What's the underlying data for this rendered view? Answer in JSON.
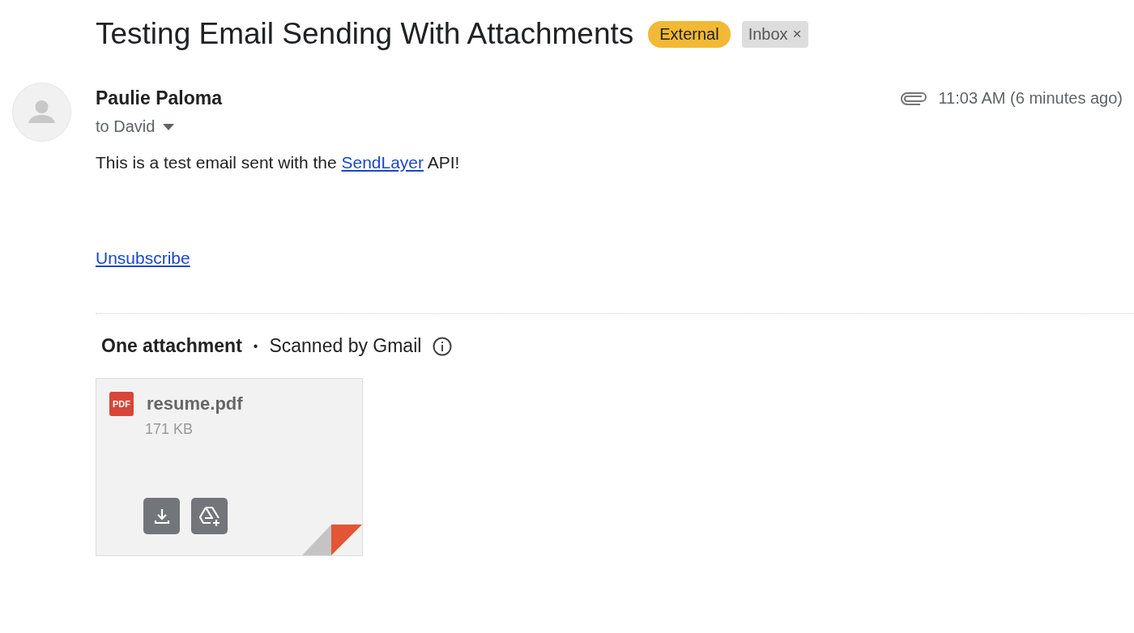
{
  "subject": "Testing Email Sending With Attachments",
  "labels": [
    {
      "text": "External",
      "color": "#f2b935"
    },
    {
      "text": "Inbox",
      "color": "#dddddd",
      "close": "×"
    }
  ],
  "sender": {
    "name": "Paulie Paloma",
    "recipient": "to David",
    "time": "11:03 AM (6 minutes ago)"
  },
  "body": {
    "before": "This is a test email sent with the ",
    "link": "SendLayer",
    "after": " API!"
  },
  "unsubscribe": "Unsubscribe",
  "attachments_header": {
    "title": "One attachment",
    "separator": "•",
    "scan": "Scanned by Gmail"
  },
  "attachments": [
    {
      "type_badge": "PDF",
      "name": "resume.pdf",
      "size": "171 KB"
    }
  ]
}
